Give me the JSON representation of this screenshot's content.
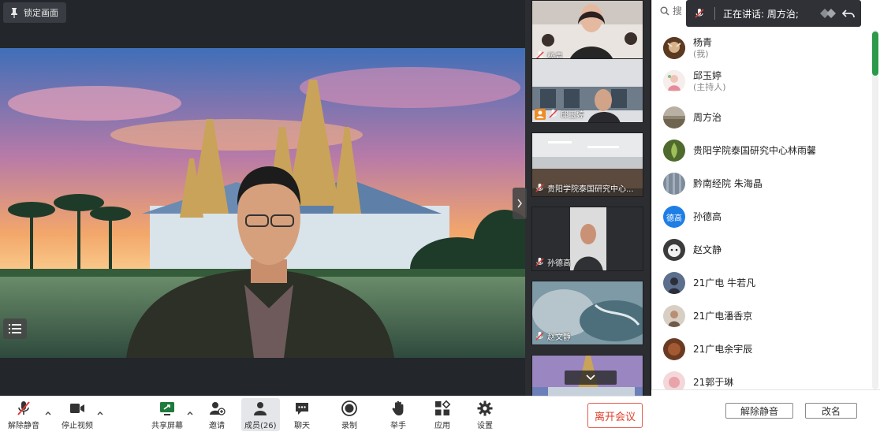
{
  "stage": {
    "lock_label": "锁定画面"
  },
  "thumbnails": [
    {
      "name": "杨青"
    },
    {
      "name": "邱玉婷"
    },
    {
      "name": "贵阳学院泰国研究中心..."
    },
    {
      "name": "孙德高"
    },
    {
      "name": "赵文静"
    },
    {
      "name": ""
    }
  ],
  "speaking": {
    "text": "正在讲话: 周方治;"
  },
  "toolbar": {
    "unmute": "解除静音",
    "stop_video": "停止视频",
    "share": "共享屏幕",
    "invite": "邀请",
    "members": "成员(26)",
    "chat": "聊天",
    "record": "录制",
    "raise_hand": "举手",
    "apps": "应用",
    "settings": "设置",
    "leave": "离开会议"
  },
  "panel": {
    "search_placeholder": "搜",
    "unmute_btn": "解除静音",
    "rename_btn": "改名",
    "members": [
      {
        "name": "杨青",
        "role": "(我)"
      },
      {
        "name": "邱玉婷",
        "role": "(主持人)"
      },
      {
        "name": "周方治",
        "role": ""
      },
      {
        "name": "贵阳学院泰国研究中心林雨馨",
        "role": ""
      },
      {
        "name": "黔南经院 朱海晶",
        "role": ""
      },
      {
        "name": "孙德高",
        "role": "",
        "avatar_text": "德高"
      },
      {
        "name": "赵文静",
        "role": ""
      },
      {
        "name": "21广电  牛若凡",
        "role": ""
      },
      {
        "name": "21广电潘香京",
        "role": ""
      },
      {
        "name": "21广电余宇辰",
        "role": ""
      },
      {
        "name": "21郭于琳",
        "role": ""
      }
    ]
  },
  "colors": {
    "accent_green": "#2d9a4b",
    "leave_red": "#e0402c",
    "avatar_blue": "#1e7ee6"
  }
}
